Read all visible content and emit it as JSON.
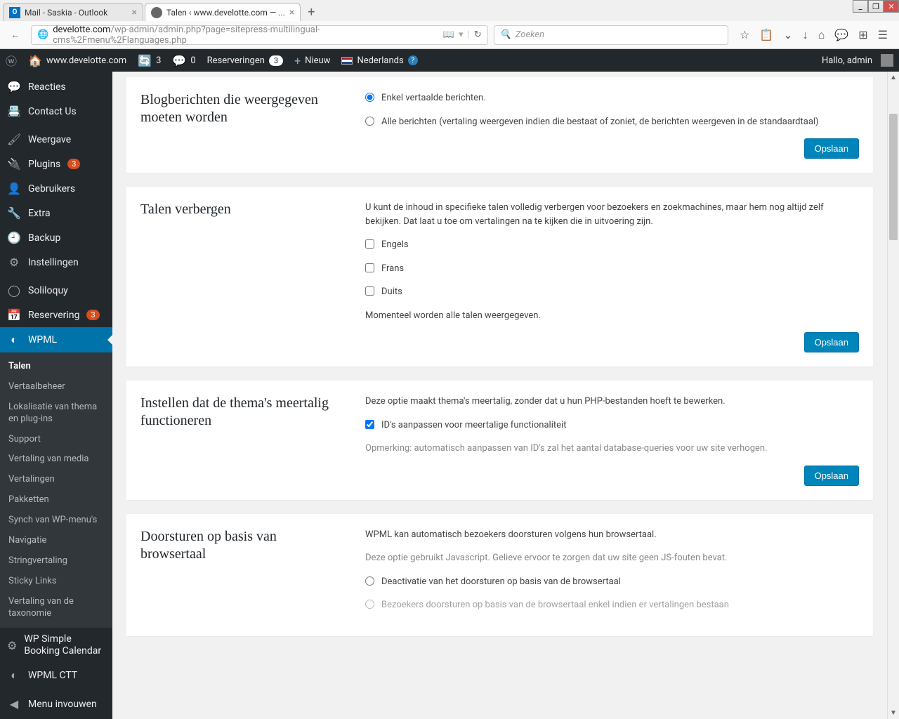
{
  "browser": {
    "tabs": [
      {
        "title": "Mail - Saskia - Outlook",
        "icon": "O",
        "iconBg": "#0072c6"
      },
      {
        "title": "Talen ‹ www.develotte.com — ...",
        "icon": "",
        "iconBg": "#666"
      }
    ],
    "url_domain": "develotte.com",
    "url_path": "/wp-admin/admin.php?page=sitepress-multilingual-cms%2Fmenu%2Flanguages.php",
    "search_placeholder": "Zoeken"
  },
  "adminbar": {
    "site_name": "www.develotte.com",
    "updates": "3",
    "comments": "0",
    "reserveringen_label": "Reserveringen",
    "reserveringen_count": "3",
    "new_label": "Nieuw",
    "lang_label": "Nederlands",
    "greeting": "Hallo, admin"
  },
  "sidebar": {
    "items": [
      {
        "label": "Reacties",
        "icon": "💬"
      },
      {
        "label": "Contact Us",
        "icon": "📇"
      },
      {
        "label": "Weergave",
        "icon": "🖌"
      },
      {
        "label": "Plugins",
        "icon": "🔌",
        "badge": "3"
      },
      {
        "label": "Gebruikers",
        "icon": "👤"
      },
      {
        "label": "Extra",
        "icon": "🔧"
      },
      {
        "label": "Backup",
        "icon": "🕘"
      },
      {
        "label": "Instellingen",
        "icon": "⚙"
      },
      {
        "label": "Soliloquy",
        "icon": "◯"
      },
      {
        "label": "Reservering",
        "icon": "📅",
        "badge": "3"
      },
      {
        "label": "WPML",
        "icon": "◐",
        "current": true
      }
    ],
    "submenu": [
      "Talen",
      "Vertaalbeheer",
      "Lokalisatie van thema en plug-ins",
      "Support",
      "Vertaling van media",
      "Vertalingen",
      "Pakketten",
      "Synch van WP-menu's",
      "Navigatie",
      "Stringvertaling",
      "Sticky Links",
      "Vertaling van de taxonomie"
    ],
    "tail": [
      {
        "label": "WP Simple Booking Calendar",
        "icon": "⚙"
      },
      {
        "label": "WPML CTT",
        "icon": "◐"
      },
      {
        "label": "Menu invouwen",
        "icon": "◀"
      }
    ]
  },
  "boxes": {
    "b1": {
      "title": "Blogberichten die weergegeven moeten worden",
      "opt1": "Enkel vertaalde berichten.",
      "opt2": "Alle berichten (vertaling weergeven indien die bestaat of zoniet, de berichten weergeven in de standaardtaal)",
      "save": "Opslaan"
    },
    "b2": {
      "title": "Talen verbergen",
      "desc": "U kunt de inhoud in specifieke talen volledig verbergen voor bezoekers en zoekmachines, maar hem nog altijd zelf bekijken. Dat laat u toe om vertalingen na te kijken die in uitvoering zijn.",
      "langs": [
        "Engels",
        "Frans",
        "Duits"
      ],
      "status": "Momenteel worden alle talen weergegeven.",
      "save": "Opslaan"
    },
    "b3": {
      "title": "Instellen dat de thema's meertalig functioneren",
      "desc": "Deze optie maakt thema's meertalig, zonder dat u hun PHP-bestanden hoeft te bewerken.",
      "check": "ID's aanpassen voor meertalige functionaliteit",
      "note": "Opmerking: automatisch aanpassen van ID's zal het aantal database-queries voor uw site verhogen.",
      "save": "Opslaan"
    },
    "b4": {
      "title": "Doorsturen op basis van browsertaal",
      "desc": "WPML kan automatisch bezoekers doorsturen volgens hun browsertaal.",
      "note": "Deze optie gebruikt Javascript. Gelieve ervoor te zorgen dat uw site geen JS-fouten bevat.",
      "opt1": "Deactivatie van het doorsturen op basis van de browsertaal",
      "opt2": "Bezoekers doorsturen op basis van de browsertaal enkel indien er vertalingen bestaan"
    }
  }
}
